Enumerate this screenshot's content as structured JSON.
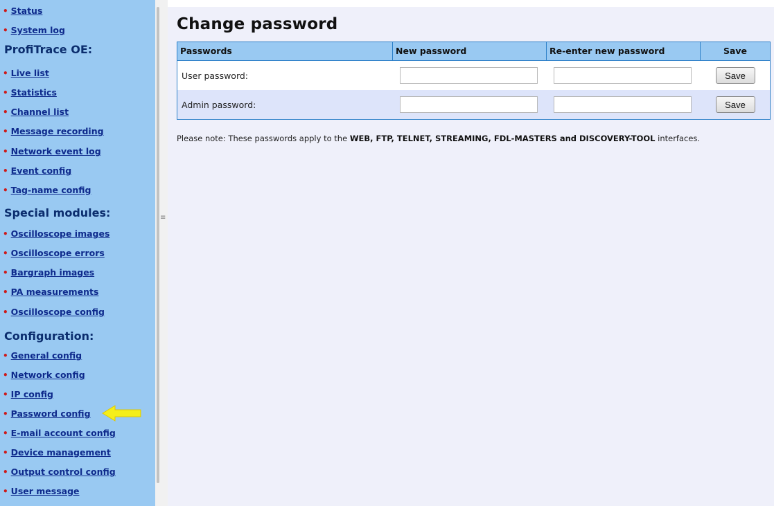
{
  "sidebar": {
    "items_top": [
      {
        "label": "Status"
      },
      {
        "label": "System log"
      }
    ],
    "sections": [
      {
        "title": "ProfiTrace OE:"
      },
      {
        "title": "Special modules:"
      },
      {
        "title": "Configuration:"
      }
    ],
    "profitrace": [
      "Live list",
      "Statistics",
      "Channel list",
      "Message recording",
      "Network event log",
      "Event config",
      "Tag-name config"
    ],
    "special": [
      "Oscilloscope images",
      "Oscilloscope errors",
      "Bargraph images",
      "PA measurements",
      "Oscilloscope config"
    ],
    "configuration": [
      "General config",
      "Network config",
      "IP config",
      "Password config",
      "E-mail account config",
      "Device management",
      "Output control config",
      "User message"
    ]
  },
  "main": {
    "title": "Change password",
    "table": {
      "headers": [
        "Passwords",
        "New password",
        "Re-enter new password",
        "Save"
      ],
      "rows": [
        {
          "label": "User password:",
          "new_value": "",
          "reenter_value": "",
          "button": "Save"
        },
        {
          "label": "Admin password:",
          "new_value": "",
          "reenter_value": "",
          "button": "Save"
        }
      ]
    },
    "note": {
      "prefix": "Please note: These passwords apply to the ",
      "bold": "WEB, FTP, TELNET, STREAMING, FDL-MASTERS and DISCOVERY-TOOL",
      "suffix": " interfaces."
    }
  },
  "colors": {
    "sidebar_bg": "#99c9f2",
    "link": "#0e2a8c",
    "bullet": "#cc1b1b",
    "main_bg": "#eff0fa",
    "table_border": "#2c7fc8",
    "arrow": "#f5ee1a"
  },
  "icons": {
    "bullet": "bullet-icon",
    "divider_grip": "grip-icon",
    "highlight_arrow": "arrow-left-icon"
  }
}
